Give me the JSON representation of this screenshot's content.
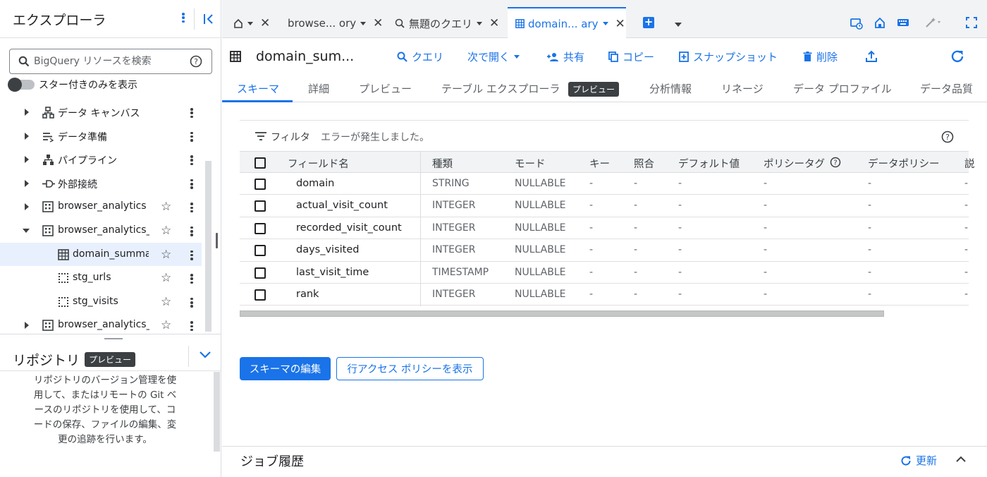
{
  "explorer": {
    "title": "エクスプローラ",
    "search_placeholder": "BigQuery リソースを検索",
    "star_toggle_label": "スター付きのみを表示",
    "tree": [
      {
        "label": "データ キャンバス",
        "icon": "data-canvas-icon",
        "expanded": false
      },
      {
        "label": "データ準備",
        "icon": "data-prep-icon",
        "expanded": false
      },
      {
        "label": "パイプライン",
        "icon": "pipeline-icon",
        "expanded": false
      },
      {
        "label": "外部接続",
        "icon": "external-connection-icon",
        "expanded": false
      },
      {
        "label": "browser_analytics",
        "icon": "dataset-icon",
        "expanded": false
      },
      {
        "label": "browser_analytics_c",
        "icon": "dataset-icon",
        "expanded": true
      },
      {
        "label": "domain_summar",
        "icon": "table-icon",
        "selected": true
      },
      {
        "label": "stg_urls",
        "icon": "view-icon"
      },
      {
        "label": "stg_visits",
        "icon": "view-icon"
      },
      {
        "label": "browser_analytics_r",
        "icon": "dataset-icon",
        "expanded": false
      }
    ]
  },
  "repository": {
    "title": "リポジトリ",
    "badge": "プレビュー",
    "description": "リポジトリのバージョン管理を使用して、またはリモートの Git ベースのリポジトリを使用して、コードの保存、ファイルの編集、変更の追跡を行います。"
  },
  "tabs": [
    {
      "label": "",
      "icon": "home-icon"
    },
    {
      "label": "browse... ory"
    },
    {
      "label": "無題のクエリ",
      "icon": "query-icon"
    },
    {
      "label": "domain... ary",
      "icon": "table-icon",
      "active": true
    }
  ],
  "toolbar": {
    "title": "domain_sum...",
    "actions": [
      "クエリ",
      "次で開く",
      "共有",
      "コピー",
      "スナップショット",
      "削除"
    ]
  },
  "subtabs": [
    "スキーマ",
    "詳細",
    "プレビュー",
    "テーブル エクスプローラ",
    "分析情報",
    "リネージ",
    "データ プロファイル",
    "データ品質"
  ],
  "subtab_badge": "プレビュー",
  "schema": {
    "filter_label": "フィルタ",
    "error_text": "エラーが発生しました。",
    "columns": [
      "フィールド名",
      "種類",
      "モード",
      "キー",
      "照合",
      "デフォルト値",
      "ポリシータグ",
      "データポリシー",
      "説"
    ],
    "rows": [
      {
        "name": "domain",
        "type": "STRING",
        "mode": "NULLABLE",
        "key": "-",
        "collation": "-",
        "default": "-",
        "policy_tag": "-",
        "data_policy": "-",
        "desc": "-"
      },
      {
        "name": "actual_visit_count",
        "type": "INTEGER",
        "mode": "NULLABLE",
        "key": "-",
        "collation": "-",
        "default": "-",
        "policy_tag": "-",
        "data_policy": "-",
        "desc": "-"
      },
      {
        "name": "recorded_visit_count",
        "type": "INTEGER",
        "mode": "NULLABLE",
        "key": "-",
        "collation": "-",
        "default": "-",
        "policy_tag": "-",
        "data_policy": "-",
        "desc": "-"
      },
      {
        "name": "days_visited",
        "type": "INTEGER",
        "mode": "NULLABLE",
        "key": "-",
        "collation": "-",
        "default": "-",
        "policy_tag": "-",
        "data_policy": "-",
        "desc": "-"
      },
      {
        "name": "last_visit_time",
        "type": "TIMESTAMP",
        "mode": "NULLABLE",
        "key": "-",
        "collation": "-",
        "default": "-",
        "policy_tag": "-",
        "data_policy": "-",
        "desc": "-"
      },
      {
        "name": "rank",
        "type": "INTEGER",
        "mode": "NULLABLE",
        "key": "-",
        "collation": "-",
        "default": "-",
        "policy_tag": "-",
        "data_policy": "-",
        "desc": "-"
      }
    ],
    "edit_button": "スキーマの編集",
    "row_access_button": "行アクセス ポリシーを表示"
  },
  "job_history": {
    "title": "ジョブ履歴",
    "refresh_label": "更新"
  },
  "colors": {
    "accent": "#1a73e8",
    "selected_bg": "#e8f0fe",
    "badge_bg": "#3c4043"
  }
}
